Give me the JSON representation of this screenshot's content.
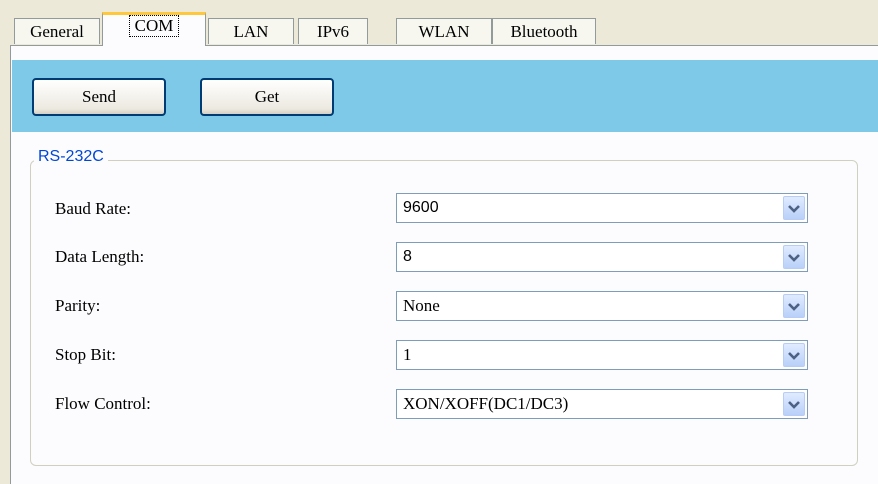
{
  "tabs": [
    {
      "label": "General",
      "active": false
    },
    {
      "label": "COM",
      "active": true
    },
    {
      "label": "LAN",
      "active": false
    },
    {
      "label": "IPv6",
      "active": false
    },
    {
      "label": "WLAN",
      "active": false
    },
    {
      "label": "Bluetooth",
      "active": false
    }
  ],
  "toolbar": {
    "background_color": "#7ec9e8",
    "send_label": "Send",
    "get_label": "Get"
  },
  "rs232c": {
    "title": "RS-232C",
    "title_color": "#0046d5",
    "fields": [
      {
        "label": "Baud Rate:",
        "value": "9600"
      },
      {
        "label": "Data Length:",
        "value": "8"
      },
      {
        "label": "Parity:",
        "value": "None"
      },
      {
        "label": "Stop Bit:",
        "value": "1"
      },
      {
        "label": "Flow Control:",
        "value": "XON/XOFF(DC1/DC3)"
      }
    ],
    "dropdown_icon": "chevron-down-icon"
  },
  "active_tab_accent_color": "#ffc83c"
}
